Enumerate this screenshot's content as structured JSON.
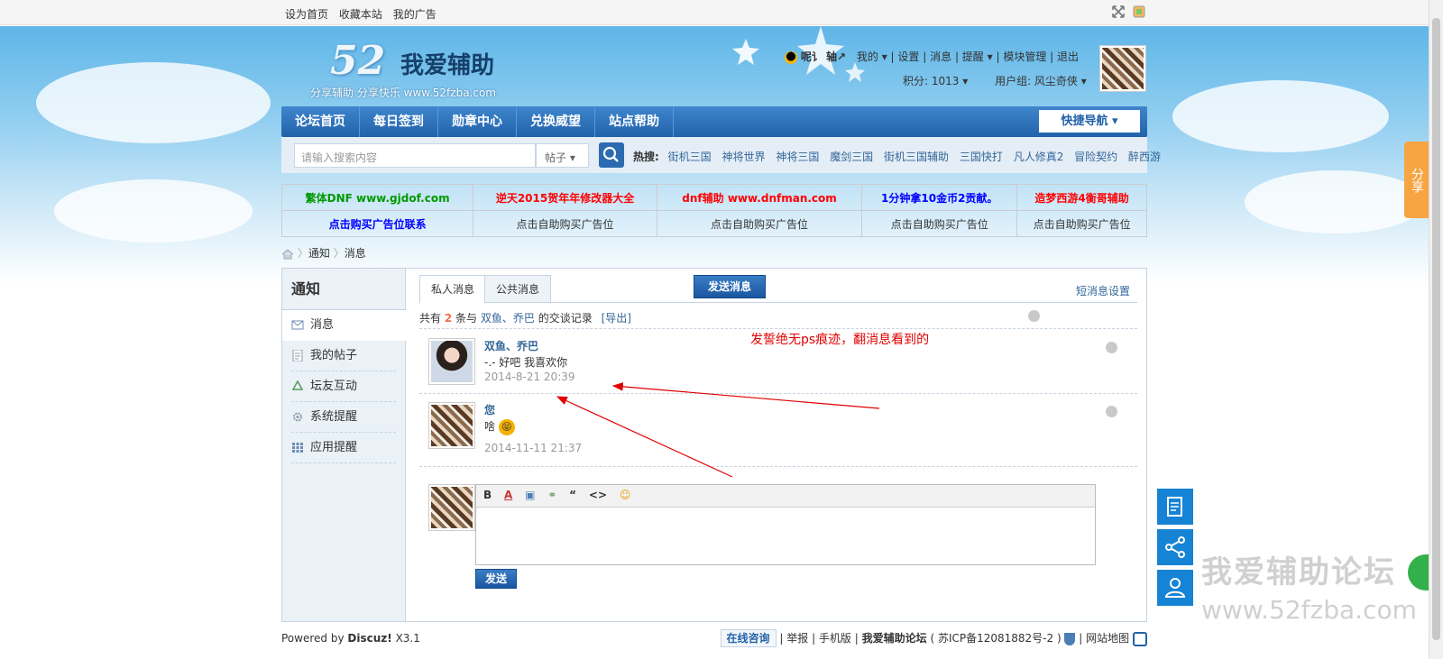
{
  "topbar": {
    "links": [
      "设为首页",
      "收藏本站",
      "我的广告"
    ]
  },
  "logo": {
    "num": "52",
    "name": "我爱辅助",
    "slogan": "分享辅助  分享快乐  www.52fzba.com"
  },
  "user": {
    "qq": "呢讠 轴↗",
    "menu": [
      "我的",
      "设置",
      "消息",
      "提醒",
      "模块管理",
      "退出"
    ],
    "points": "积分: 1013",
    "group": "用户组: 风尘奇侠"
  },
  "nav": {
    "items": [
      "论坛首页",
      "每日签到",
      "勋章中心",
      "兑换威望",
      "站点帮助"
    ],
    "quick": "快捷导航"
  },
  "search": {
    "placeholder": "请输入搜索内容",
    "type": "帖子",
    "hot_label": "热搜:",
    "hot": [
      "街机三国",
      "神将世界",
      "神将三国",
      "魔剑三国",
      "街机三国辅助",
      "三国快打",
      "凡人修真2",
      "冒险契约",
      "醉西游"
    ]
  },
  "ads": {
    "row1": [
      {
        "t": "繁体DNF www.gjdof.com",
        "c": "#009900"
      },
      {
        "t": "逆天2015贺年年修改器大全",
        "c": "#ff0000"
      },
      {
        "t": "dnf辅助 www.dnfman.com",
        "c": "#ff0000"
      },
      {
        "t": "1分钟拿10金币2贡献。",
        "c": "#0000ff"
      },
      {
        "t": "造梦西游4衡哥辅助",
        "c": "#ff0000"
      }
    ],
    "row2": [
      {
        "t": "点击购买广告位联系",
        "c": "#0000ff"
      },
      {
        "t": "点击自助购买广告位",
        "c": "#333333"
      },
      {
        "t": "点击自助购买广告位",
        "c": "#333333"
      },
      {
        "t": "点击自助购买广告位",
        "c": "#333333"
      },
      {
        "t": "点击自助购买广告位",
        "c": "#333333"
      }
    ]
  },
  "breadcrumb": [
    "通知",
    "消息"
  ],
  "sidebar": {
    "title": "通知",
    "current": "消息",
    "items": [
      "我的帖子",
      "坛友互动",
      "系统提醒",
      "应用提醒"
    ]
  },
  "tabs": {
    "private": "私人消息",
    "public": "公共消息",
    "send": "发送消息",
    "settings": "短消息设置"
  },
  "summary": {
    "prefix": "共有",
    "count": "2",
    "middle": "条与",
    "users": "双鱼、乔巴",
    "suffix": "的交谈记录",
    "export": "[导出]"
  },
  "messages": [
    {
      "name": "双鱼、乔巴",
      "text": "-.-  好吧  我喜欢你",
      "time": "2014-8-21 20:39"
    },
    {
      "name": "您",
      "text": "啥",
      "time": "2014-11-11 21:37"
    }
  ],
  "annotation": "发誓绝无ps痕迹，翻消息看到的",
  "editor": {
    "tools": [
      "B",
      "A",
      "▣",
      "⚭",
      "“",
      "<>",
      "☺"
    ],
    "submit": "发送"
  },
  "footer": {
    "powered": "Powered by",
    "brand": "Discuz!",
    "version": "X3.1",
    "online": "在线咨询",
    "links": [
      "举报",
      "手机版"
    ],
    "site": "我爱辅助论坛",
    "icp": "( 苏ICP备12081882号-2 )",
    "sitemap": "网站地图"
  },
  "share": "分享",
  "watermark": {
    "line1": "我爱辅助论坛",
    "line2": "www.52fzba.com"
  }
}
